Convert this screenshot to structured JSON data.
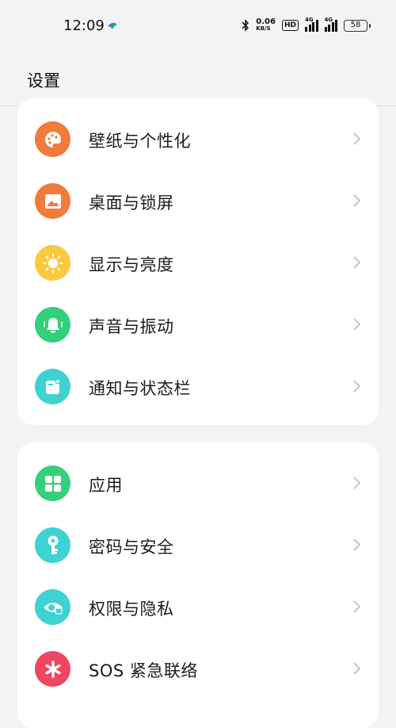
{
  "status": {
    "time": "12:09",
    "net_speed_value": "0.06",
    "net_speed_unit": "KB/S",
    "hd_label": "HD",
    "sig1_label": "4G",
    "sig2_label": "4G",
    "battery": "58"
  },
  "header": {
    "title": "设置"
  },
  "group1": [
    {
      "label": "壁纸与个性化",
      "icon": "palette-icon",
      "color": "#f27a3a"
    },
    {
      "label": "桌面与锁屏",
      "icon": "image-icon",
      "color": "#f27a3a"
    },
    {
      "label": "显示与亮度",
      "icon": "sun-icon",
      "color": "#fbc83e"
    },
    {
      "label": "声音与振动",
      "icon": "bell-icon",
      "color": "#34cf7a"
    },
    {
      "label": "通知与状态栏",
      "icon": "notification-icon",
      "color": "#3ed2d2"
    }
  ],
  "group2": [
    {
      "label": "应用",
      "icon": "apps-grid-icon",
      "color": "#34cf7a"
    },
    {
      "label": "密码与安全",
      "icon": "key-icon",
      "color": "#3ed2d2"
    },
    {
      "label": "权限与隐私",
      "icon": "privacy-eye-icon",
      "color": "#3ed2d2"
    },
    {
      "label": "SOS 紧急联络",
      "icon": "sos-asterisk-icon",
      "color": "#ee4663"
    }
  ]
}
